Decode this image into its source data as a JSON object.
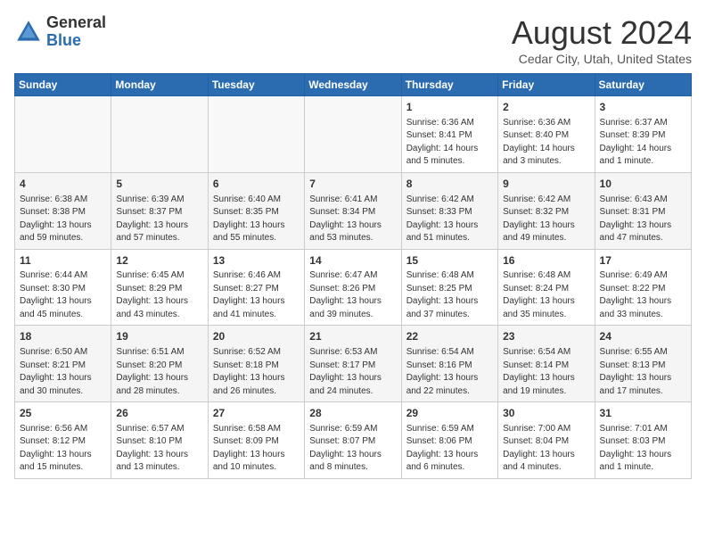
{
  "header": {
    "logo_general": "General",
    "logo_blue": "Blue",
    "month_title": "August 2024",
    "location": "Cedar City, Utah, United States"
  },
  "weekdays": [
    "Sunday",
    "Monday",
    "Tuesday",
    "Wednesday",
    "Thursday",
    "Friday",
    "Saturday"
  ],
  "weeks": [
    [
      {
        "day": "",
        "info": ""
      },
      {
        "day": "",
        "info": ""
      },
      {
        "day": "",
        "info": ""
      },
      {
        "day": "",
        "info": ""
      },
      {
        "day": "1",
        "info": "Sunrise: 6:36 AM\nSunset: 8:41 PM\nDaylight: 14 hours\nand 5 minutes."
      },
      {
        "day": "2",
        "info": "Sunrise: 6:36 AM\nSunset: 8:40 PM\nDaylight: 14 hours\nand 3 minutes."
      },
      {
        "day": "3",
        "info": "Sunrise: 6:37 AM\nSunset: 8:39 PM\nDaylight: 14 hours\nand 1 minute."
      }
    ],
    [
      {
        "day": "4",
        "info": "Sunrise: 6:38 AM\nSunset: 8:38 PM\nDaylight: 13 hours\nand 59 minutes."
      },
      {
        "day": "5",
        "info": "Sunrise: 6:39 AM\nSunset: 8:37 PM\nDaylight: 13 hours\nand 57 minutes."
      },
      {
        "day": "6",
        "info": "Sunrise: 6:40 AM\nSunset: 8:35 PM\nDaylight: 13 hours\nand 55 minutes."
      },
      {
        "day": "7",
        "info": "Sunrise: 6:41 AM\nSunset: 8:34 PM\nDaylight: 13 hours\nand 53 minutes."
      },
      {
        "day": "8",
        "info": "Sunrise: 6:42 AM\nSunset: 8:33 PM\nDaylight: 13 hours\nand 51 minutes."
      },
      {
        "day": "9",
        "info": "Sunrise: 6:42 AM\nSunset: 8:32 PM\nDaylight: 13 hours\nand 49 minutes."
      },
      {
        "day": "10",
        "info": "Sunrise: 6:43 AM\nSunset: 8:31 PM\nDaylight: 13 hours\nand 47 minutes."
      }
    ],
    [
      {
        "day": "11",
        "info": "Sunrise: 6:44 AM\nSunset: 8:30 PM\nDaylight: 13 hours\nand 45 minutes."
      },
      {
        "day": "12",
        "info": "Sunrise: 6:45 AM\nSunset: 8:29 PM\nDaylight: 13 hours\nand 43 minutes."
      },
      {
        "day": "13",
        "info": "Sunrise: 6:46 AM\nSunset: 8:27 PM\nDaylight: 13 hours\nand 41 minutes."
      },
      {
        "day": "14",
        "info": "Sunrise: 6:47 AM\nSunset: 8:26 PM\nDaylight: 13 hours\nand 39 minutes."
      },
      {
        "day": "15",
        "info": "Sunrise: 6:48 AM\nSunset: 8:25 PM\nDaylight: 13 hours\nand 37 minutes."
      },
      {
        "day": "16",
        "info": "Sunrise: 6:48 AM\nSunset: 8:24 PM\nDaylight: 13 hours\nand 35 minutes."
      },
      {
        "day": "17",
        "info": "Sunrise: 6:49 AM\nSunset: 8:22 PM\nDaylight: 13 hours\nand 33 minutes."
      }
    ],
    [
      {
        "day": "18",
        "info": "Sunrise: 6:50 AM\nSunset: 8:21 PM\nDaylight: 13 hours\nand 30 minutes."
      },
      {
        "day": "19",
        "info": "Sunrise: 6:51 AM\nSunset: 8:20 PM\nDaylight: 13 hours\nand 28 minutes."
      },
      {
        "day": "20",
        "info": "Sunrise: 6:52 AM\nSunset: 8:18 PM\nDaylight: 13 hours\nand 26 minutes."
      },
      {
        "day": "21",
        "info": "Sunrise: 6:53 AM\nSunset: 8:17 PM\nDaylight: 13 hours\nand 24 minutes."
      },
      {
        "day": "22",
        "info": "Sunrise: 6:54 AM\nSunset: 8:16 PM\nDaylight: 13 hours\nand 22 minutes."
      },
      {
        "day": "23",
        "info": "Sunrise: 6:54 AM\nSunset: 8:14 PM\nDaylight: 13 hours\nand 19 minutes."
      },
      {
        "day": "24",
        "info": "Sunrise: 6:55 AM\nSunset: 8:13 PM\nDaylight: 13 hours\nand 17 minutes."
      }
    ],
    [
      {
        "day": "25",
        "info": "Sunrise: 6:56 AM\nSunset: 8:12 PM\nDaylight: 13 hours\nand 15 minutes."
      },
      {
        "day": "26",
        "info": "Sunrise: 6:57 AM\nSunset: 8:10 PM\nDaylight: 13 hours\nand 13 minutes."
      },
      {
        "day": "27",
        "info": "Sunrise: 6:58 AM\nSunset: 8:09 PM\nDaylight: 13 hours\nand 10 minutes."
      },
      {
        "day": "28",
        "info": "Sunrise: 6:59 AM\nSunset: 8:07 PM\nDaylight: 13 hours\nand 8 minutes."
      },
      {
        "day": "29",
        "info": "Sunrise: 6:59 AM\nSunset: 8:06 PM\nDaylight: 13 hours\nand 6 minutes."
      },
      {
        "day": "30",
        "info": "Sunrise: 7:00 AM\nSunset: 8:04 PM\nDaylight: 13 hours\nand 4 minutes."
      },
      {
        "day": "31",
        "info": "Sunrise: 7:01 AM\nSunset: 8:03 PM\nDaylight: 13 hours\nand 1 minute."
      }
    ]
  ]
}
